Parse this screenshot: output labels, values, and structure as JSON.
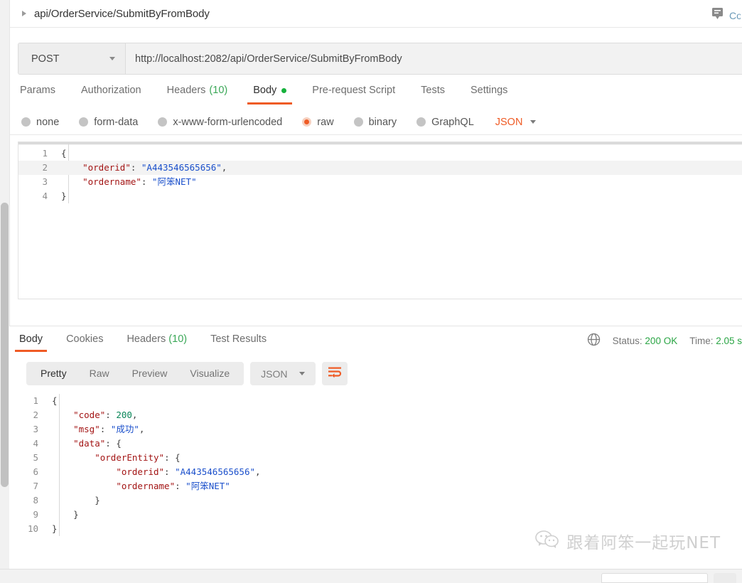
{
  "breadcrumb": {
    "caret_icon": "caret-right-icon",
    "path": "api/OrderService/SubmitByFromBody",
    "comment_icon": "comment-icon",
    "comment_label": "Co"
  },
  "request": {
    "method": "POST",
    "url": "http://localhost:2082/api/OrderService/SubmitByFromBody",
    "tabs": [
      {
        "label": "Params",
        "active": false
      },
      {
        "label": "Authorization",
        "active": false
      },
      {
        "label": "Headers",
        "count": "(10)",
        "active": false
      },
      {
        "label": "Body",
        "active": true,
        "dot": true
      },
      {
        "label": "Pre-request Script",
        "active": false
      },
      {
        "label": "Tests",
        "active": false
      },
      {
        "label": "Settings",
        "active": false
      }
    ],
    "body_types": [
      {
        "label": "none",
        "selected": false
      },
      {
        "label": "form-data",
        "selected": false
      },
      {
        "label": "x-www-form-urlencoded",
        "selected": false
      },
      {
        "label": "raw",
        "selected": true
      },
      {
        "label": "binary",
        "selected": false
      },
      {
        "label": "GraphQL",
        "selected": false
      }
    ],
    "format_selected": "JSON",
    "body_lines": [
      {
        "n": "1",
        "highlight": false,
        "tokens": [
          {
            "t": "{",
            "c": "p"
          }
        ]
      },
      {
        "n": "2",
        "highlight": true,
        "tokens": [
          {
            "t": "    ",
            "c": "p"
          },
          {
            "t": "\"orderid\"",
            "c": "k"
          },
          {
            "t": ": ",
            "c": "p"
          },
          {
            "t": "\"A443546565656\"",
            "c": "s"
          },
          {
            "t": ",",
            "c": "p"
          }
        ]
      },
      {
        "n": "3",
        "highlight": false,
        "tokens": [
          {
            "t": "    ",
            "c": "p"
          },
          {
            "t": "\"ordername\"",
            "c": "k"
          },
          {
            "t": ": ",
            "c": "p"
          },
          {
            "t": "\"阿笨NET\"",
            "c": "s"
          }
        ]
      },
      {
        "n": "4",
        "highlight": false,
        "tokens": [
          {
            "t": "}",
            "c": "p"
          }
        ]
      }
    ]
  },
  "response": {
    "tabs": [
      {
        "label": "Body",
        "active": true
      },
      {
        "label": "Cookies",
        "active": false
      },
      {
        "label": "Headers",
        "count": "(10)",
        "active": false
      },
      {
        "label": "Test Results",
        "active": false
      }
    ],
    "globe_icon": "globe-icon",
    "status_label": "Status:",
    "status_value": "200 OK",
    "time_label": "Time:",
    "time_value": "2.05 s",
    "view_modes": [
      {
        "label": "Pretty",
        "active": true
      },
      {
        "label": "Raw",
        "active": false
      },
      {
        "label": "Preview",
        "active": false
      },
      {
        "label": "Visualize",
        "active": false
      }
    ],
    "format_selected": "JSON",
    "wrap_icon": "word-wrap-icon",
    "body_lines": [
      {
        "n": "1",
        "tokens": [
          {
            "t": "{",
            "c": "p"
          }
        ]
      },
      {
        "n": "2",
        "tokens": [
          {
            "t": "    ",
            "c": "p"
          },
          {
            "t": "\"code\"",
            "c": "k"
          },
          {
            "t": ": ",
            "c": "p"
          },
          {
            "t": "200",
            "c": "n"
          },
          {
            "t": ",",
            "c": "p"
          }
        ]
      },
      {
        "n": "3",
        "tokens": [
          {
            "t": "    ",
            "c": "p"
          },
          {
            "t": "\"msg\"",
            "c": "k"
          },
          {
            "t": ": ",
            "c": "p"
          },
          {
            "t": "\"成功\"",
            "c": "s"
          },
          {
            "t": ",",
            "c": "p"
          }
        ]
      },
      {
        "n": "4",
        "tokens": [
          {
            "t": "    ",
            "c": "p"
          },
          {
            "t": "\"data\"",
            "c": "k"
          },
          {
            "t": ": {",
            "c": "p"
          }
        ]
      },
      {
        "n": "5",
        "tokens": [
          {
            "t": "        ",
            "c": "p"
          },
          {
            "t": "\"orderEntity\"",
            "c": "k"
          },
          {
            "t": ": {",
            "c": "p"
          }
        ]
      },
      {
        "n": "6",
        "tokens": [
          {
            "t": "            ",
            "c": "p"
          },
          {
            "t": "\"orderid\"",
            "c": "k"
          },
          {
            "t": ": ",
            "c": "p"
          },
          {
            "t": "\"A443546565656\"",
            "c": "s"
          },
          {
            "t": ",",
            "c": "p"
          }
        ]
      },
      {
        "n": "7",
        "tokens": [
          {
            "t": "            ",
            "c": "p"
          },
          {
            "t": "\"ordername\"",
            "c": "k"
          },
          {
            "t": ": ",
            "c": "p"
          },
          {
            "t": "\"阿笨NET\"",
            "c": "s"
          }
        ]
      },
      {
        "n": "8",
        "tokens": [
          {
            "t": "        }",
            "c": "p"
          }
        ]
      },
      {
        "n": "9",
        "tokens": [
          {
            "t": "    }",
            "c": "p"
          }
        ]
      },
      {
        "n": "10",
        "tokens": [
          {
            "t": "}",
            "c": "p"
          }
        ]
      }
    ]
  },
  "watermark": {
    "icon": "wechat-icon",
    "text": "跟着阿笨一起玩NET"
  },
  "colors": {
    "accent": "#ef5b25",
    "success": "#2aa544",
    "key": "#a31515",
    "string": "#1a4fcb",
    "number": "#098658"
  }
}
